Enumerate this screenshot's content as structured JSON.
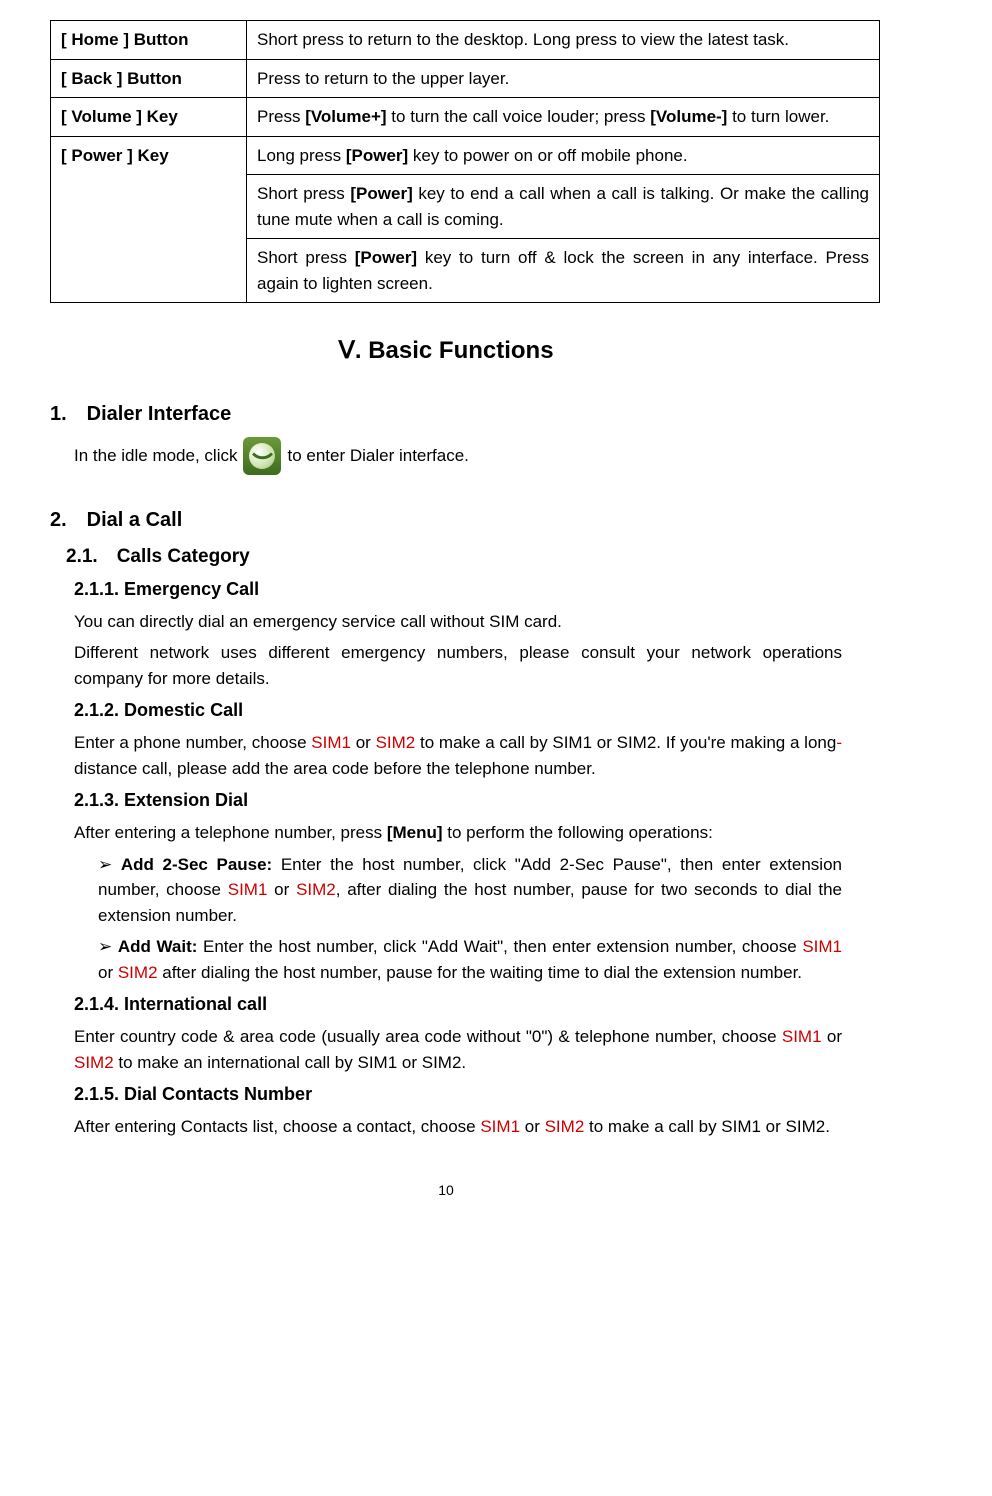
{
  "table": {
    "rows": [
      {
        "label": "[ Home ] Button",
        "desc_before": "Short press to return to the desktop. Long press to view the latest task."
      },
      {
        "label": "[ Back ] Button",
        "desc_before": "Press to return to the upper layer."
      },
      {
        "label": "[ Volume ] Key",
        "desc_before": "Press ",
        "bold1": "[Volume+]",
        "mid": " to turn the call voice louder; press ",
        "bold2": "[Volume-]",
        "after": " to turn lower."
      }
    ],
    "power": {
      "label": "[ Power ] Key",
      "r1_before": "Long press ",
      "r1_bold": "[Power]",
      "r1_after": " key to power on or off mobile phone.",
      "r2_before": "Short press ",
      "r2_bold": "[Power]",
      "r2_after": " key to end a call when a call is talking. Or make the calling tune mute when a call is coming.",
      "r3_before": "Short press ",
      "r3_bold": "[Power]",
      "r3_after": " key to turn off & lock the screen in any interface. Press again to lighten screen."
    }
  },
  "section_title": "Ⅴ. Basic Functions",
  "h2_1": "1. Dialer Interface",
  "p_dialer_before": "In the idle mode, click ",
  "p_dialer_after": " to enter Dialer interface.",
  "h2_2": "2. Dial a Call",
  "h3_21": "2.1. Calls Category",
  "h4_211": "2.1.1.  Emergency Call",
  "p_211a": "You can directly dial an emergency service call without SIM card.",
  "p_211b": "Different network uses different emergency numbers, please consult your network operations company for more details.",
  "h4_212": "2.1.2.  Domestic Call",
  "p_212_a": "Enter a phone number, choose ",
  "sim1": "SIM1",
  "or_space": " or ",
  "sim2": "SIM2",
  "p_212_b": " to make a call by SIM1 or SIM2. If you're making a long",
  "hyphen_red": "-",
  "p_212_c": "distance call, please add the area code before the telephone number.",
  "h4_213": "2.1.3.  Extension Dial",
  "p_213_before": "After entering a telephone number, press ",
  "p_213_bold": "[Menu]",
  "p_213_after": " to perform the following operations:",
  "bullet_arrow": "➢",
  "b1_bold": "Add 2-Sec Pause: ",
  "b1_a": "Enter the host number, click \"Add 2-Sec Pause\", then enter extension number, choose ",
  "b1_b": ", after dialing the host number, pause for two seconds to dial the extension number.",
  "b2_bold": "Add Wait: ",
  "b2_a": "Enter the host number, click \"Add Wait\", then enter extension number, choose ",
  "b2_b": " after dialing the host number, pause for the waiting time to dial the extension number.",
  "h4_214": "2.1.4.  International call",
  "p_214_a": "Enter country code & area code (usually area code without \"0\") & telephone number, choose ",
  "p_214_b": " to make an international call by SIM1 or SIM2.",
  "h4_215": "2.1.5.  Dial Contacts Number",
  "p_215_a": "After entering Contacts list, choose a contact, choose ",
  "p_215_b": " to make a call by SIM1 or SIM2.",
  "page_number": "10"
}
